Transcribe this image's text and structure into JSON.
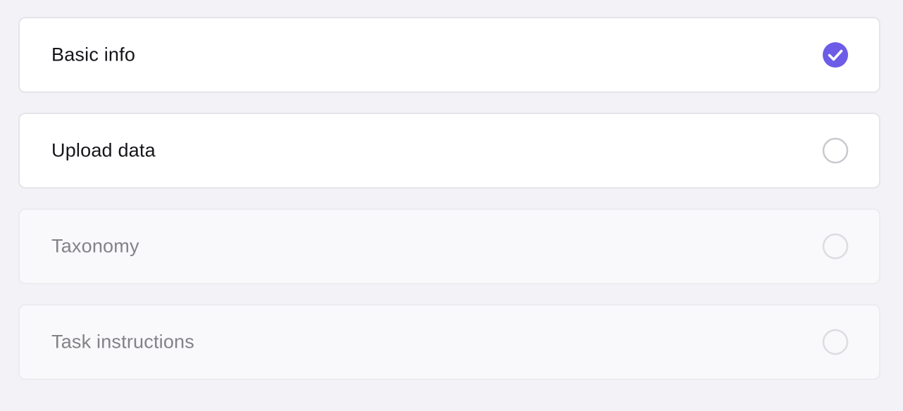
{
  "steps": [
    {
      "label": "Basic info",
      "status": "complete",
      "enabled": true,
      "icon": "check-circle-icon"
    },
    {
      "label": "Upload data",
      "status": "incomplete",
      "enabled": true,
      "icon": "empty-circle-icon"
    },
    {
      "label": "Taxonomy",
      "status": "incomplete",
      "enabled": false,
      "icon": "empty-circle-icon"
    },
    {
      "label": "Task instructions",
      "status": "incomplete",
      "enabled": false,
      "icon": "empty-circle-icon"
    }
  ],
  "colors": {
    "accent": "#6c5ce7",
    "circle_enabled": "#c9c9cf",
    "circle_disabled": "#dcdce1"
  }
}
